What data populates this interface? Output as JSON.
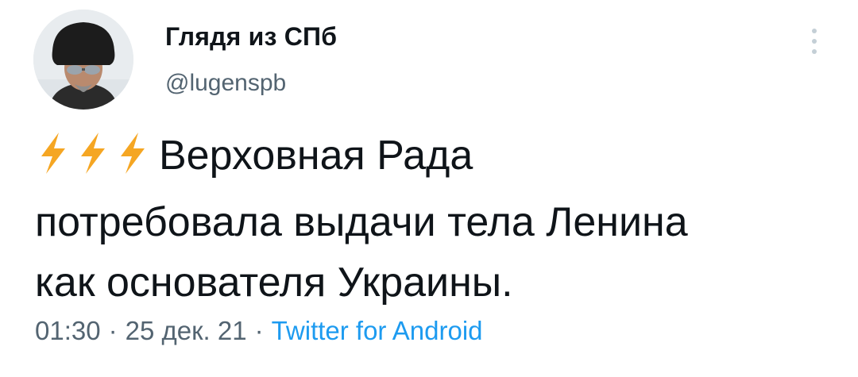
{
  "author": {
    "display_name": "Глядя из СПб",
    "handle": "@lugenspb"
  },
  "tweet": {
    "lines": [
      "Верховная Рада",
      "потребовала выдачи тела Ленина",
      "как основателя Украины."
    ],
    "emoji": [
      "high-voltage-icon",
      "high-voltage-icon",
      "high-voltage-icon"
    ]
  },
  "meta": {
    "time": "01:30",
    "separator": "·",
    "date": "25 дек. 21",
    "source": "Twitter for Android"
  },
  "colors": {
    "text": "#0f1419",
    "secondary": "#536471",
    "link": "#1d9bf0",
    "bolt": "#f5a623"
  }
}
